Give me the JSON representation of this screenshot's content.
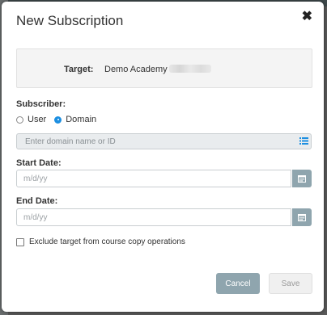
{
  "dialog": {
    "title": "New Subscription",
    "close_glyph": "✖"
  },
  "target": {
    "label": "Target:",
    "value": "Demo Academy"
  },
  "subscriber": {
    "label": "Subscriber:",
    "options": [
      "User",
      "Domain"
    ],
    "selected": "Domain"
  },
  "domain_field": {
    "placeholder": "Enter domain name or ID",
    "icon": "list-icon"
  },
  "start_date": {
    "label": "Start Date:",
    "placeholder": "m/d/yy",
    "icon": "calendar-icon"
  },
  "end_date": {
    "label": "End Date:",
    "placeholder": "m/d/yy",
    "icon": "calendar-icon"
  },
  "exclude_option": {
    "label": "Exclude target from course copy operations",
    "checked": false
  },
  "buttons": {
    "cancel": "Cancel",
    "save": "Save"
  },
  "colors": {
    "accent_blue": "#1d8fe1",
    "button_slate": "#8fa5ae",
    "panel_bg": "#f4f4f4"
  }
}
